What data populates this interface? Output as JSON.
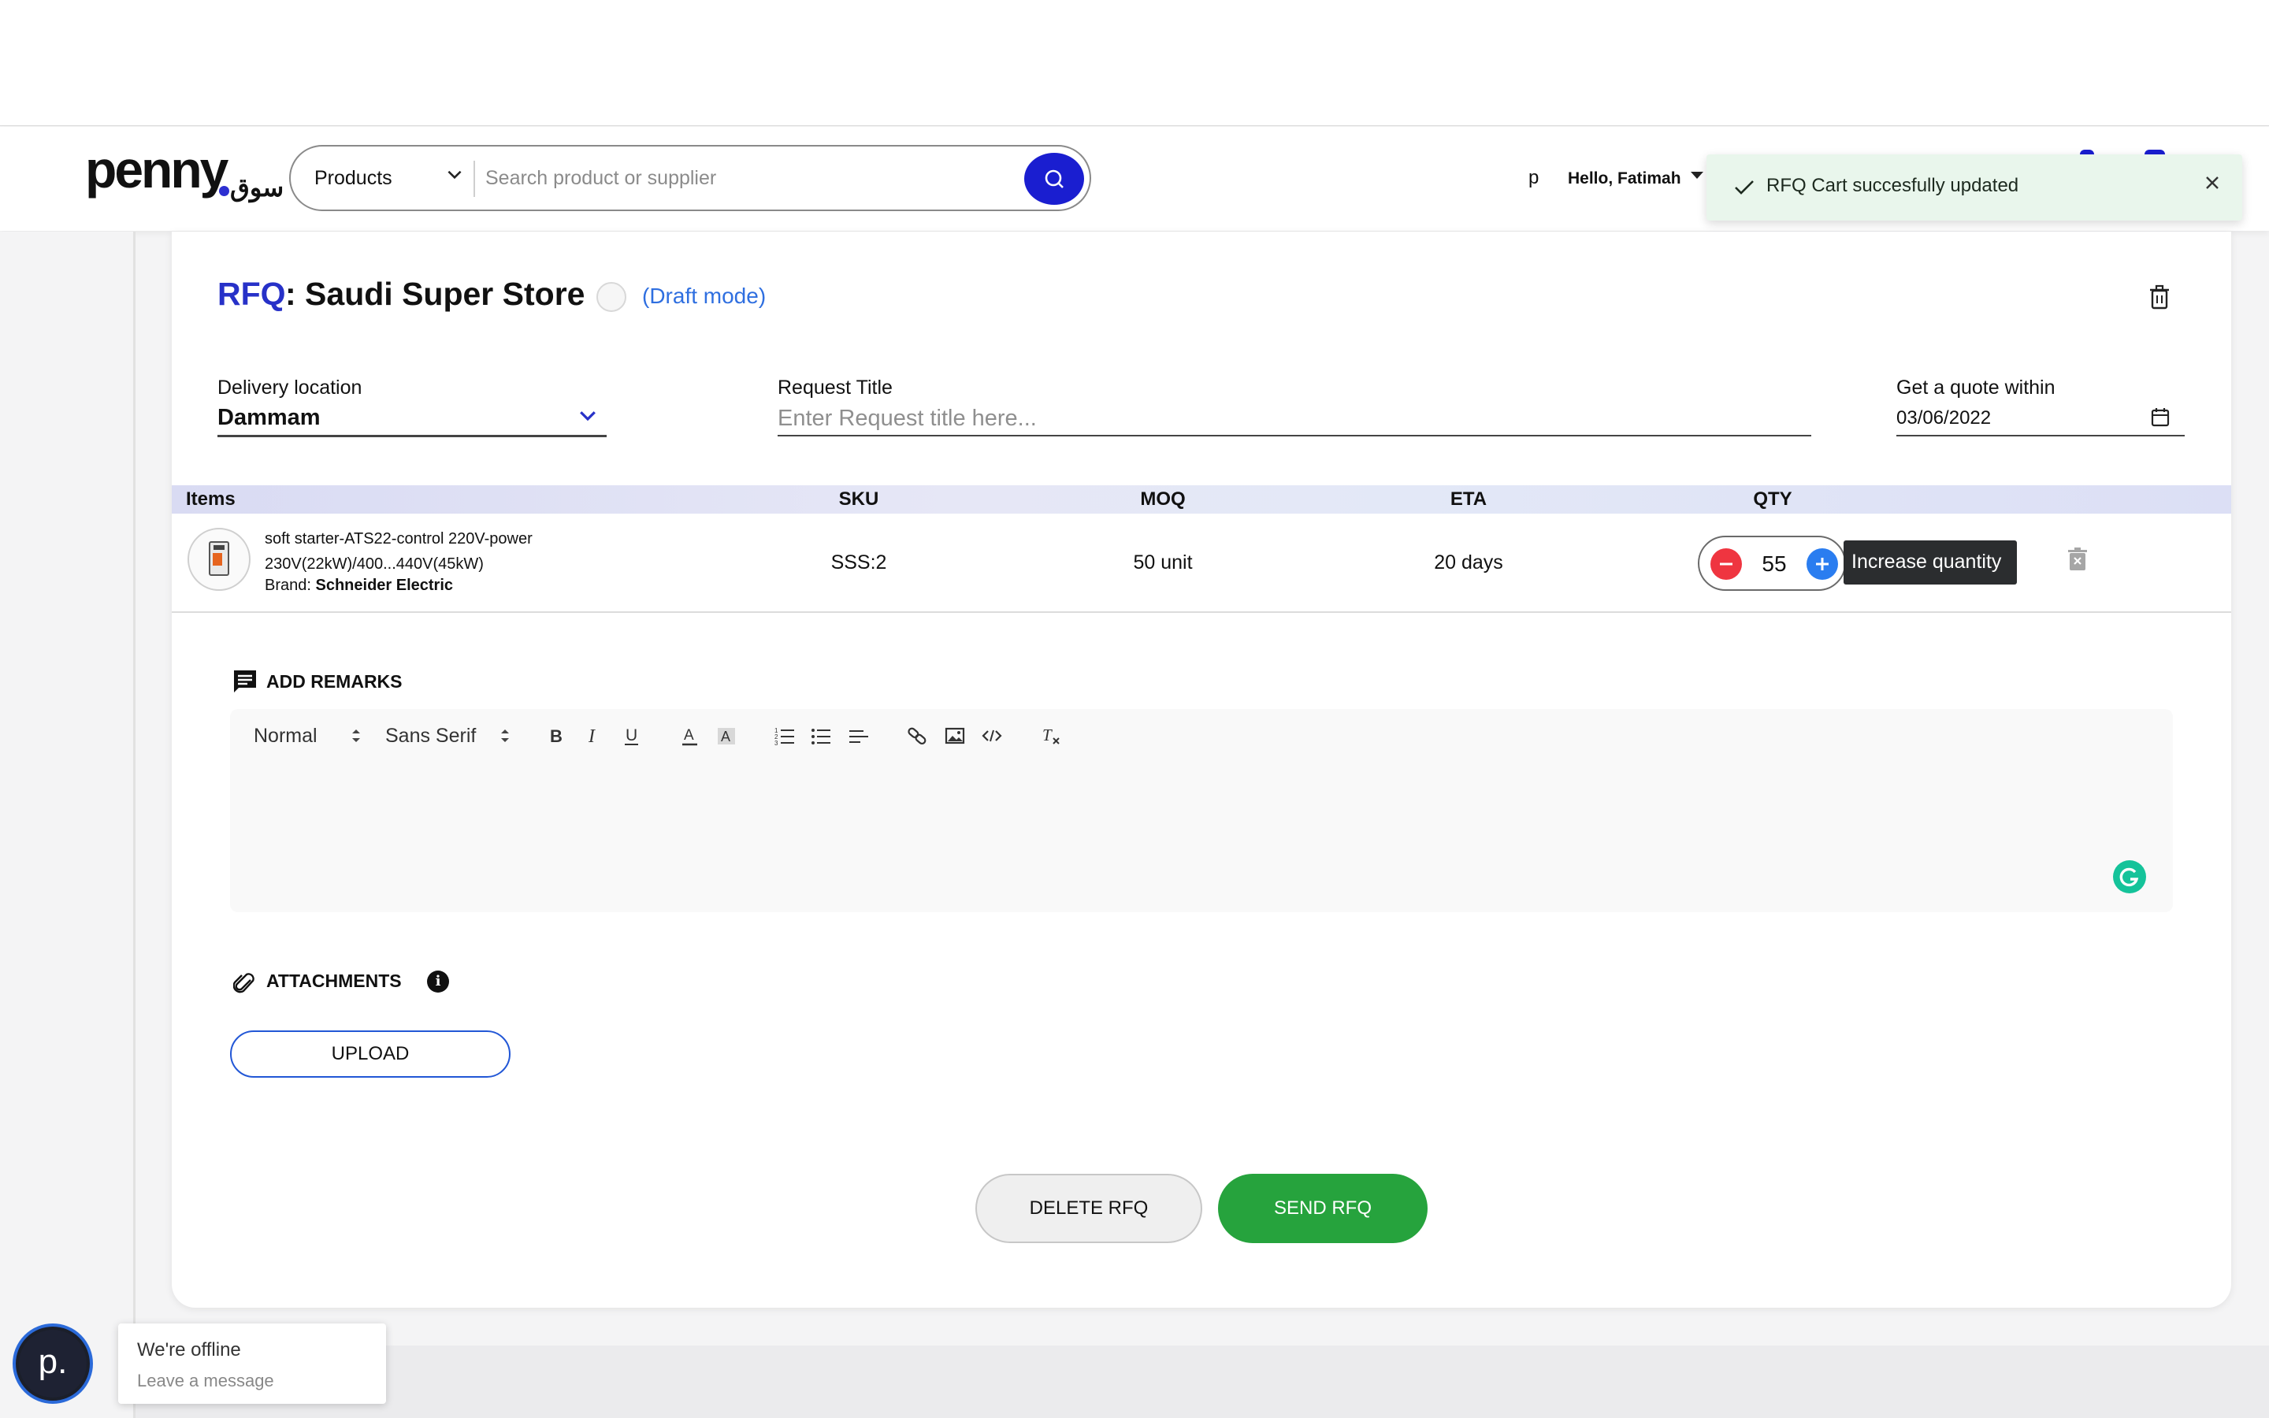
{
  "header": {
    "logo_text": "penny",
    "logo_arabic": "سوق",
    "search": {
      "category": "Products",
      "placeholder": "Search product or supplier"
    },
    "user_initial": "p",
    "greeting": "Hello, Fatimah"
  },
  "toast": {
    "message": "RFQ Cart succesfully updated"
  },
  "rfq": {
    "prefix": "RFQ",
    "store_name": ": Saudi Super Store",
    "mode": "(Draft mode)",
    "delivery": {
      "label": "Delivery location",
      "value": "Dammam"
    },
    "request_title": {
      "label": "Request Title",
      "placeholder": "Enter Request title here..."
    },
    "quote_within": {
      "label": "Get a quote within",
      "value": "03/06/2022"
    }
  },
  "table": {
    "headers": [
      "Items",
      "SKU",
      "MOQ",
      "ETA",
      "QTY"
    ],
    "rows": [
      {
        "name": "soft starter-ATS22-control 220V-power 230V(22kW)/400...440V(45kW)",
        "brand_label": "Brand:",
        "brand": "Schneider Electric",
        "sku": "SSS:2",
        "moq": "50 unit",
        "eta": "20 days",
        "qty": "55"
      }
    ],
    "tooltip": "Increase quantity"
  },
  "remarks": {
    "title": "ADD REMARKS",
    "toolbar": {
      "size": "Normal",
      "font": "Sans Serif"
    }
  },
  "attachments": {
    "title": "ATTACHMENTS",
    "info": "i",
    "upload_label": "UPLOAD"
  },
  "actions": {
    "delete_label": "DELETE RFQ",
    "send_label": "SEND RFQ"
  },
  "chat": {
    "avatar_letter": "p.",
    "status": "We're offline",
    "cta": "Leave a message"
  },
  "colors": {
    "brand_blue": "#1a1ed0",
    "send_green": "#26a33d",
    "minus_red": "#ef3540",
    "plus_blue": "#2a7df0"
  }
}
